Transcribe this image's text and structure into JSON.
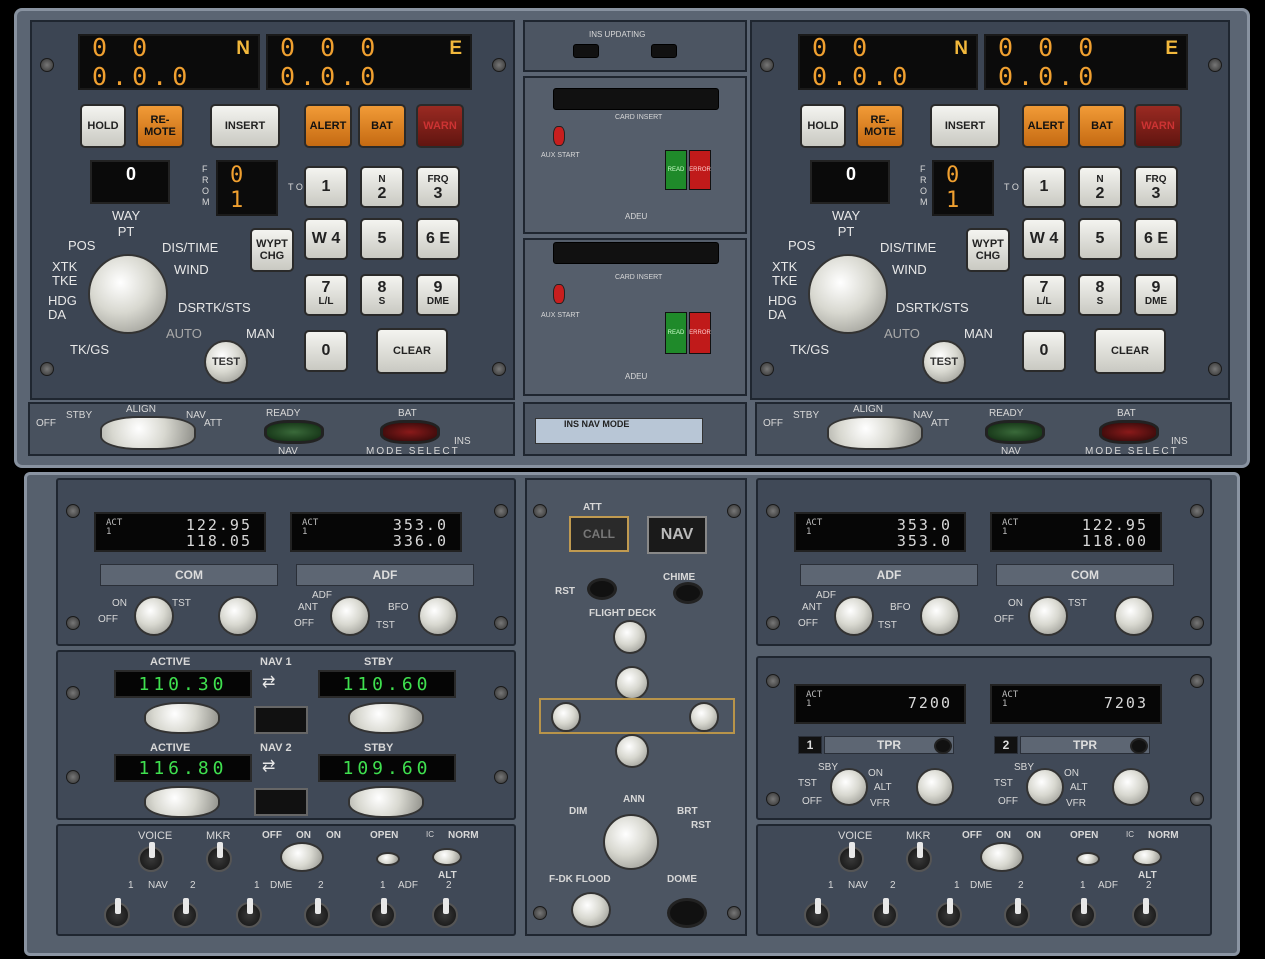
{
  "ins_left": {
    "north": "0 0 0.0.0",
    "north_letter": "N",
    "east": "0 0 0 0.0.0",
    "east_letter": "E",
    "buttons": {
      "hold": "HOLD",
      "remote": "RE-\nMOTE",
      "insert": "INSERT",
      "alert": "ALERT",
      "bat": "BAT",
      "warn": "WARN",
      "wypt": "WYPT\nCHG",
      "clear": "CLEAR"
    },
    "from_wheel": "0",
    "from_label": "F R O M",
    "to_display": "0 1",
    "to_label": "T O",
    "keypad": [
      {
        "main": "1",
        "sub": ""
      },
      {
        "main": "2",
        "sub": "N",
        "subtop": true
      },
      {
        "main": "3",
        "sub": "FRQ",
        "subtop": true
      },
      {
        "main": "W 4",
        "sub": ""
      },
      {
        "main": "5",
        "sub": ""
      },
      {
        "main": "6 E",
        "sub": ""
      },
      {
        "main": "7",
        "sub": "L/L"
      },
      {
        "main": "8",
        "sub": "S"
      },
      {
        "main": "9",
        "sub": "DME"
      },
      {
        "main": "0",
        "sub": ""
      }
    ],
    "selector": [
      "WAY\nPT",
      "POS",
      "DIS/TIME",
      "XTK\nTKE",
      "WIND",
      "HDG\nDA",
      "DSRTK/STS",
      "TK/GS",
      "AUTO",
      "MAN"
    ],
    "test": "TEST"
  },
  "ins_right": {
    "north": "0 0 0.0.0",
    "north_letter": "N",
    "east": "0 0 0 0.0.0",
    "east_letter": "E",
    "from_wheel": "0",
    "to_display": "0 1"
  },
  "mode_select": {
    "stby": "STBY",
    "align": "ALIGN",
    "nav": "NAV",
    "off": "OFF",
    "att": "ATT",
    "ready": "READY",
    "nav2": "NAV",
    "bat": "BAT",
    "ins": "INS",
    "mode": "MODE SELECT"
  },
  "adeu": {
    "ins_updating": "INS UPDATING",
    "card_insert": "CARD INSERT",
    "aux_start": "AUX START",
    "read": "READ",
    "error": "ERROR",
    "adeu": "ADEU",
    "nav_mode": "INS NAV MODE"
  },
  "com_left": {
    "act": "ACT\n1",
    "active": "122.95",
    "stby": "118.05",
    "name": "COM",
    "on": "ON",
    "off": "OFF",
    "tst": "TST"
  },
  "adf_left": {
    "act": "ACT\n1",
    "active": "353.0",
    "stby": "336.0",
    "name": "ADF",
    "ant": "ANT",
    "adf": "ADF",
    "off": "OFF",
    "bfo": "BFO",
    "tst": "TST"
  },
  "adf_right": {
    "act": "ACT\n1",
    "active": "353.0",
    "stby": "353.0",
    "name": "ADF"
  },
  "com_right": {
    "act": "ACT\n1",
    "active": "122.95",
    "stby": "118.00",
    "name": "COM"
  },
  "nav1": {
    "active_lbl": "ACTIVE",
    "name": "NAV 1",
    "stby_lbl": "STBY",
    "active": "110.30",
    "stby": "110.60"
  },
  "nav2": {
    "active_lbl": "ACTIVE",
    "name": "NAV 2",
    "stby_lbl": "STBY",
    "active": "116.80",
    "stby": "109.60"
  },
  "tpr1": {
    "act": "ACT\n1",
    "code": "7200",
    "num": "1",
    "name": "TPR",
    "sby": "SBY",
    "on": "ON",
    "tst": "TST",
    "alt": "ALT",
    "off": "OFF",
    "vfr": "VFR"
  },
  "tpr2": {
    "act": "ACT\n1",
    "code": "7203",
    "num": "2",
    "name": "TPR"
  },
  "center": {
    "att": "ATT",
    "call": "CALL",
    "nav": "NAV",
    "rst": "RST",
    "chime": "CHIME",
    "flight_deck": "FLIGHT DECK",
    "dim": "DIM",
    "ann": "ANN",
    "brt": "BRT",
    "rst2": "RST",
    "fdk_flood": "F-DK FLOOD",
    "dome": "DOME"
  },
  "audio": {
    "voice": "VOICE",
    "mkr": "MKR",
    "off": "OFF",
    "on": "ON",
    "on2": "ON",
    "open": "OPEN",
    "ic": "IC",
    "norm": "NORM",
    "alt": "ALT",
    "nav": "NAV",
    "dme": "DME",
    "adf": "ADF",
    "one": "1",
    "two": "2"
  }
}
